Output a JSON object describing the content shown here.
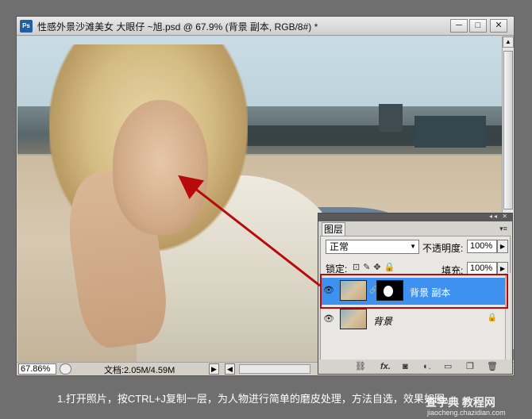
{
  "window": {
    "title": "性感外景沙滩美女  大眼仔 ~旭.psd @ 67.9% (背景 副本, RGB/8#) *",
    "app_icon": "Ps",
    "minimize": "─",
    "maximize": "□",
    "close": "✕"
  },
  "statusbar": {
    "zoom": "67.86%",
    "doc_info": "文档:2.05M/4.59M",
    "arrow": "▶",
    "scroll_left": "◀"
  },
  "layers_panel": {
    "tab": "图层",
    "menu_icon": "▾≡",
    "blend_mode": "正常",
    "opacity_label": "不透明度:",
    "opacity": "100%",
    "lock_label": "锁定:",
    "fill_label": "填充:",
    "fill": "100%",
    "layers": [
      {
        "name": "背景 副本",
        "selected": true,
        "has_mask": true
      },
      {
        "name": "背景",
        "selected": false,
        "locked": true
      }
    ],
    "footer_icons": [
      "link-icon",
      "fx-icon",
      "mask-icon",
      "adjustment-icon",
      "folder-icon",
      "new-layer-icon",
      "trash-icon"
    ]
  },
  "caption": "1.打开照片，按CTRL+J复制一层，为人物进行简单的磨皮处理，方法自选，效果如图。",
  "watermark": {
    "top": "查字典 教程网",
    "bottom": "jiaocheng.chazidian.com"
  },
  "colors": {
    "selection": "#3f91f0",
    "highlight": "#b80a0a",
    "background": "#6f6f6f"
  }
}
